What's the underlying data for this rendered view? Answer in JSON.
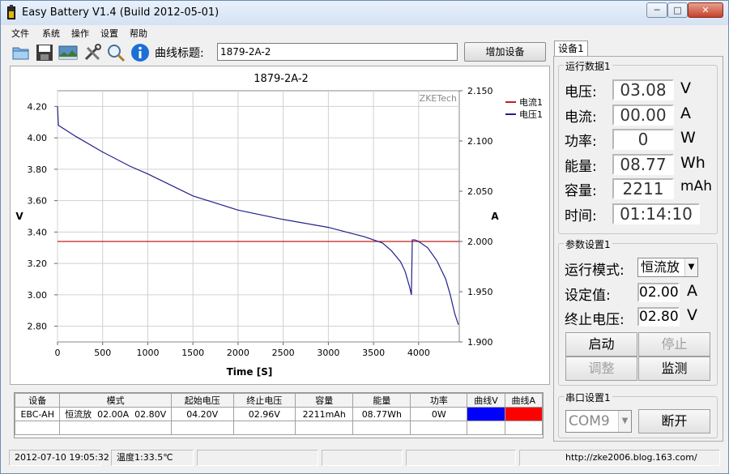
{
  "window": {
    "title": "Easy Battery V1.4 (Build 2012-05-01)",
    "buttons": [
      "─",
      "□",
      "✕"
    ]
  },
  "menu": [
    "文件",
    "系统",
    "操作",
    "设置",
    "帮助"
  ],
  "toolbar": {
    "icons": [
      "open-folder-icon",
      "save-icon",
      "image-icon",
      "tools-icon",
      "search-icon",
      "info-icon"
    ],
    "curve_title_label": "曲线标题:",
    "curve_title_value": "1879-2A-2",
    "add_device_label": "增加设备"
  },
  "chart_data": {
    "type": "line",
    "title": "1879-2A-2",
    "watermark": "ZKETech",
    "xlabel": "Time [S]",
    "ylabel_left": "V",
    "ylabel_right": "A",
    "xlim": [
      0,
      4450
    ],
    "ylim_left": [
      2.7,
      4.3
    ],
    "ylim_right": [
      1.9,
      2.15
    ],
    "x_ticks": [
      "0",
      "500",
      "1000",
      "1500",
      "2000",
      "2500",
      "3000",
      "3500",
      "4000"
    ],
    "y_left_ticks": [
      "2.80",
      "3.00",
      "3.20",
      "3.40",
      "3.60",
      "3.80",
      "4.00",
      "4.20"
    ],
    "y_right_ticks": [
      "1.900",
      "1.950",
      "2.000",
      "2.050",
      "2.100",
      "2.150"
    ],
    "grid": true,
    "legend_position": "top-right",
    "series": [
      {
        "name": "电流1",
        "color": "#c02020",
        "axis": "right",
        "x": [
          0,
          3920,
          3930,
          4450
        ],
        "y": [
          2.0,
          2.0,
          2.0,
          2.0
        ]
      },
      {
        "name": "电压1",
        "color": "#20208c",
        "axis": "left",
        "x": [
          0,
          10,
          200,
          500,
          800,
          1000,
          1500,
          2000,
          2500,
          3000,
          3200,
          3400,
          3500,
          3600,
          3700,
          3800,
          3850,
          3900,
          3920,
          3930,
          3940,
          3960,
          4000,
          4100,
          4200,
          4300,
          4350,
          4400,
          4440
        ],
        "y": [
          4.2,
          4.08,
          4.01,
          3.91,
          3.82,
          3.77,
          3.63,
          3.54,
          3.48,
          3.43,
          3.4,
          3.37,
          3.35,
          3.33,
          3.28,
          3.21,
          3.15,
          3.05,
          3.0,
          3.35,
          3.35,
          3.35,
          3.34,
          3.3,
          3.22,
          3.1,
          3.0,
          2.88,
          2.81
        ]
      }
    ]
  },
  "table": {
    "headers": [
      "设备",
      "模式",
      "起始电压",
      "终止电压",
      "容量",
      "能量",
      "功率",
      "曲线V",
      "曲线A"
    ],
    "rows": [
      [
        "EBC-AH",
        "恒流放  02.00A  02.80V",
        "04.20V",
        "02.96V",
        "2211mAh",
        "08.77Wh",
        "0W",
        "",
        ""
      ]
    ],
    "curve_v_color": "#0000ff",
    "curve_a_color": "#ff0000"
  },
  "status": {
    "datetime": "2012-07-10 19:05:32",
    "temperature": "温度1:33.5℃",
    "url": "http://zke2006.blog.163.com/"
  },
  "right_panel": {
    "tab_label": "设备1",
    "run_data_title": "运行数据1",
    "voltage_label": "电压:",
    "voltage_value": "03.08",
    "voltage_unit": "V",
    "current_label": "电流:",
    "current_value": "00.00",
    "current_unit": "A",
    "power_label": "功率:",
    "power_value": "0",
    "power_unit": "W",
    "energy_label": "能量:",
    "energy_value": "08.77",
    "energy_unit": "Wh",
    "capacity_label": "容量:",
    "capacity_value": "2211",
    "capacity_unit": "mAh",
    "time_label": "时间:",
    "time_value": "01:14:10",
    "params_title": "参数设置1",
    "mode_label": "运行模式:",
    "mode_value": "恒流放",
    "setpoint_label": "设定值:",
    "setpoint_value": "02.00",
    "setpoint_unit": "A",
    "cutoff_label": "终止电压:",
    "cutoff_value": "02.80",
    "cutoff_unit": "V",
    "start_label": "启动",
    "stop_label": "停止",
    "adjust_label": "调整",
    "monitor_label": "监测",
    "serial_title": "串口设置1",
    "com_value": "COM9",
    "disconnect_label": "断开"
  }
}
